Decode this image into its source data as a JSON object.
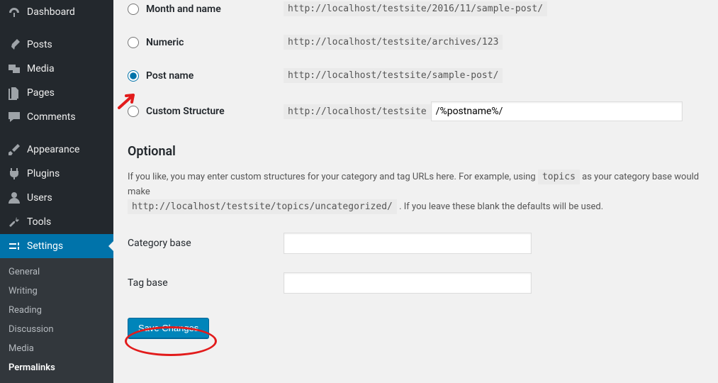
{
  "sidebar": {
    "items": [
      {
        "label": "Dashboard",
        "icon": "dashboard"
      },
      {
        "label": "Posts",
        "icon": "pin"
      },
      {
        "label": "Media",
        "icon": "media"
      },
      {
        "label": "Pages",
        "icon": "pages"
      },
      {
        "label": "Comments",
        "icon": "comment"
      },
      {
        "label": "Appearance",
        "icon": "brush"
      },
      {
        "label": "Plugins",
        "icon": "plug"
      },
      {
        "label": "Users",
        "icon": "user"
      },
      {
        "label": "Tools",
        "icon": "tools"
      },
      {
        "label": "Settings",
        "icon": "settings"
      }
    ],
    "sub": [
      "General",
      "Writing",
      "Reading",
      "Discussion",
      "Media",
      "Permalinks"
    ],
    "sub_current": "Permalinks"
  },
  "options": {
    "month_name": {
      "label": "Month and name",
      "example": "http://localhost/testsite/2016/11/sample-post/",
      "checked": false
    },
    "numeric": {
      "label": "Numeric",
      "example": "http://localhost/testsite/archives/123",
      "checked": false
    },
    "post_name": {
      "label": "Post name",
      "example": "http://localhost/testsite/sample-post/",
      "checked": true
    },
    "custom": {
      "label": "Custom Structure",
      "base": "http://localhost/testsite",
      "value": "/%postname%/",
      "checked": false
    }
  },
  "optional": {
    "heading": "Optional",
    "desc_part1": "If you like, you may enter custom structures for your category and tag URLs here. For example, using ",
    "desc_code1": "topics",
    "desc_part2": " as your category base would make",
    "desc_code2": "http://localhost/testsite/topics/uncategorized/",
    "desc_part3": " . If you leave these blank the defaults will be used.",
    "category_label": "Category base",
    "category_value": "",
    "tag_label": "Tag base",
    "tag_value": ""
  },
  "save_label": "Save Changes"
}
